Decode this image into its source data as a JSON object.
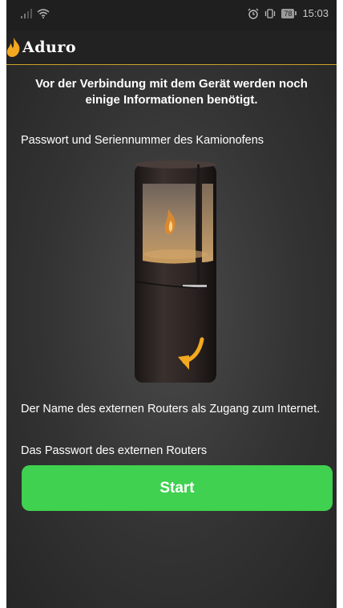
{
  "status_bar": {
    "battery": "78",
    "time": "15:03"
  },
  "app": {
    "brand": "Aduro"
  },
  "main": {
    "heading": "Vor der Verbindung mit dem Gerät werden noch einige Informationen benötigt.",
    "info_1": "Passwort und Seriennummer des Kamionofens",
    "info_2": "Der Name des externen Routers als Zugang zum Internet.",
    "info_3": "Das Passwort des externen Routers",
    "start_label": "Start"
  },
  "colors": {
    "accent_green": "#3fd14f",
    "brand_gold": "#f3a81f",
    "background": "#2a2a2a"
  }
}
